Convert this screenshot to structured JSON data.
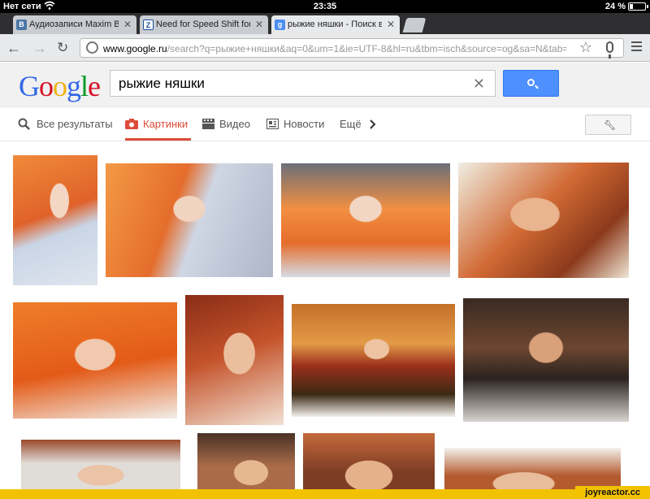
{
  "status_bar": {
    "carrier": "Нет сети",
    "time": "23:35",
    "battery": "24 %",
    "battery_level_percent": 24
  },
  "tabs": [
    {
      "title": "Аудиозаписи Maxim Bogd",
      "favicon": "vk-icon",
      "active": false
    },
    {
      "title": "Need for Speed Shift for iPa",
      "favicon": "page-icon",
      "active": false
    },
    {
      "title": "рыжие няшки - Поиск в G",
      "favicon": "google-icon",
      "active": true
    }
  ],
  "toolbar": {
    "url_domain": "www.google.ru",
    "url_rest": "/search?q=рыжие+няшки&aq=0&um=1&ie=UTF-8&hl=ru&tbm=isch&source=og&sa=N&tab=wi&ei=UjZV"
  },
  "google": {
    "logo": [
      "G",
      "o",
      "o",
      "g",
      "l",
      "e"
    ],
    "query": "рыжие няшки"
  },
  "categories": [
    {
      "label": "Все результаты",
      "icon": "search-icon",
      "active": false
    },
    {
      "label": "Картинки",
      "icon": "camera-icon",
      "active": true
    },
    {
      "label": "Видео",
      "icon": "film-icon",
      "active": false
    },
    {
      "label": "Новости",
      "icon": "newspaper-icon",
      "active": false
    },
    {
      "label": "Ещё",
      "icon": "chevron-right-icon",
      "active": false
    }
  ],
  "image_results": {
    "count_visible": 12
  },
  "watermark": "joyreactor.cc",
  "colors": {
    "accent_red": "#dd4b39",
    "search_blue": "#4d90fe",
    "watermark_yellow": "#f2c200"
  }
}
